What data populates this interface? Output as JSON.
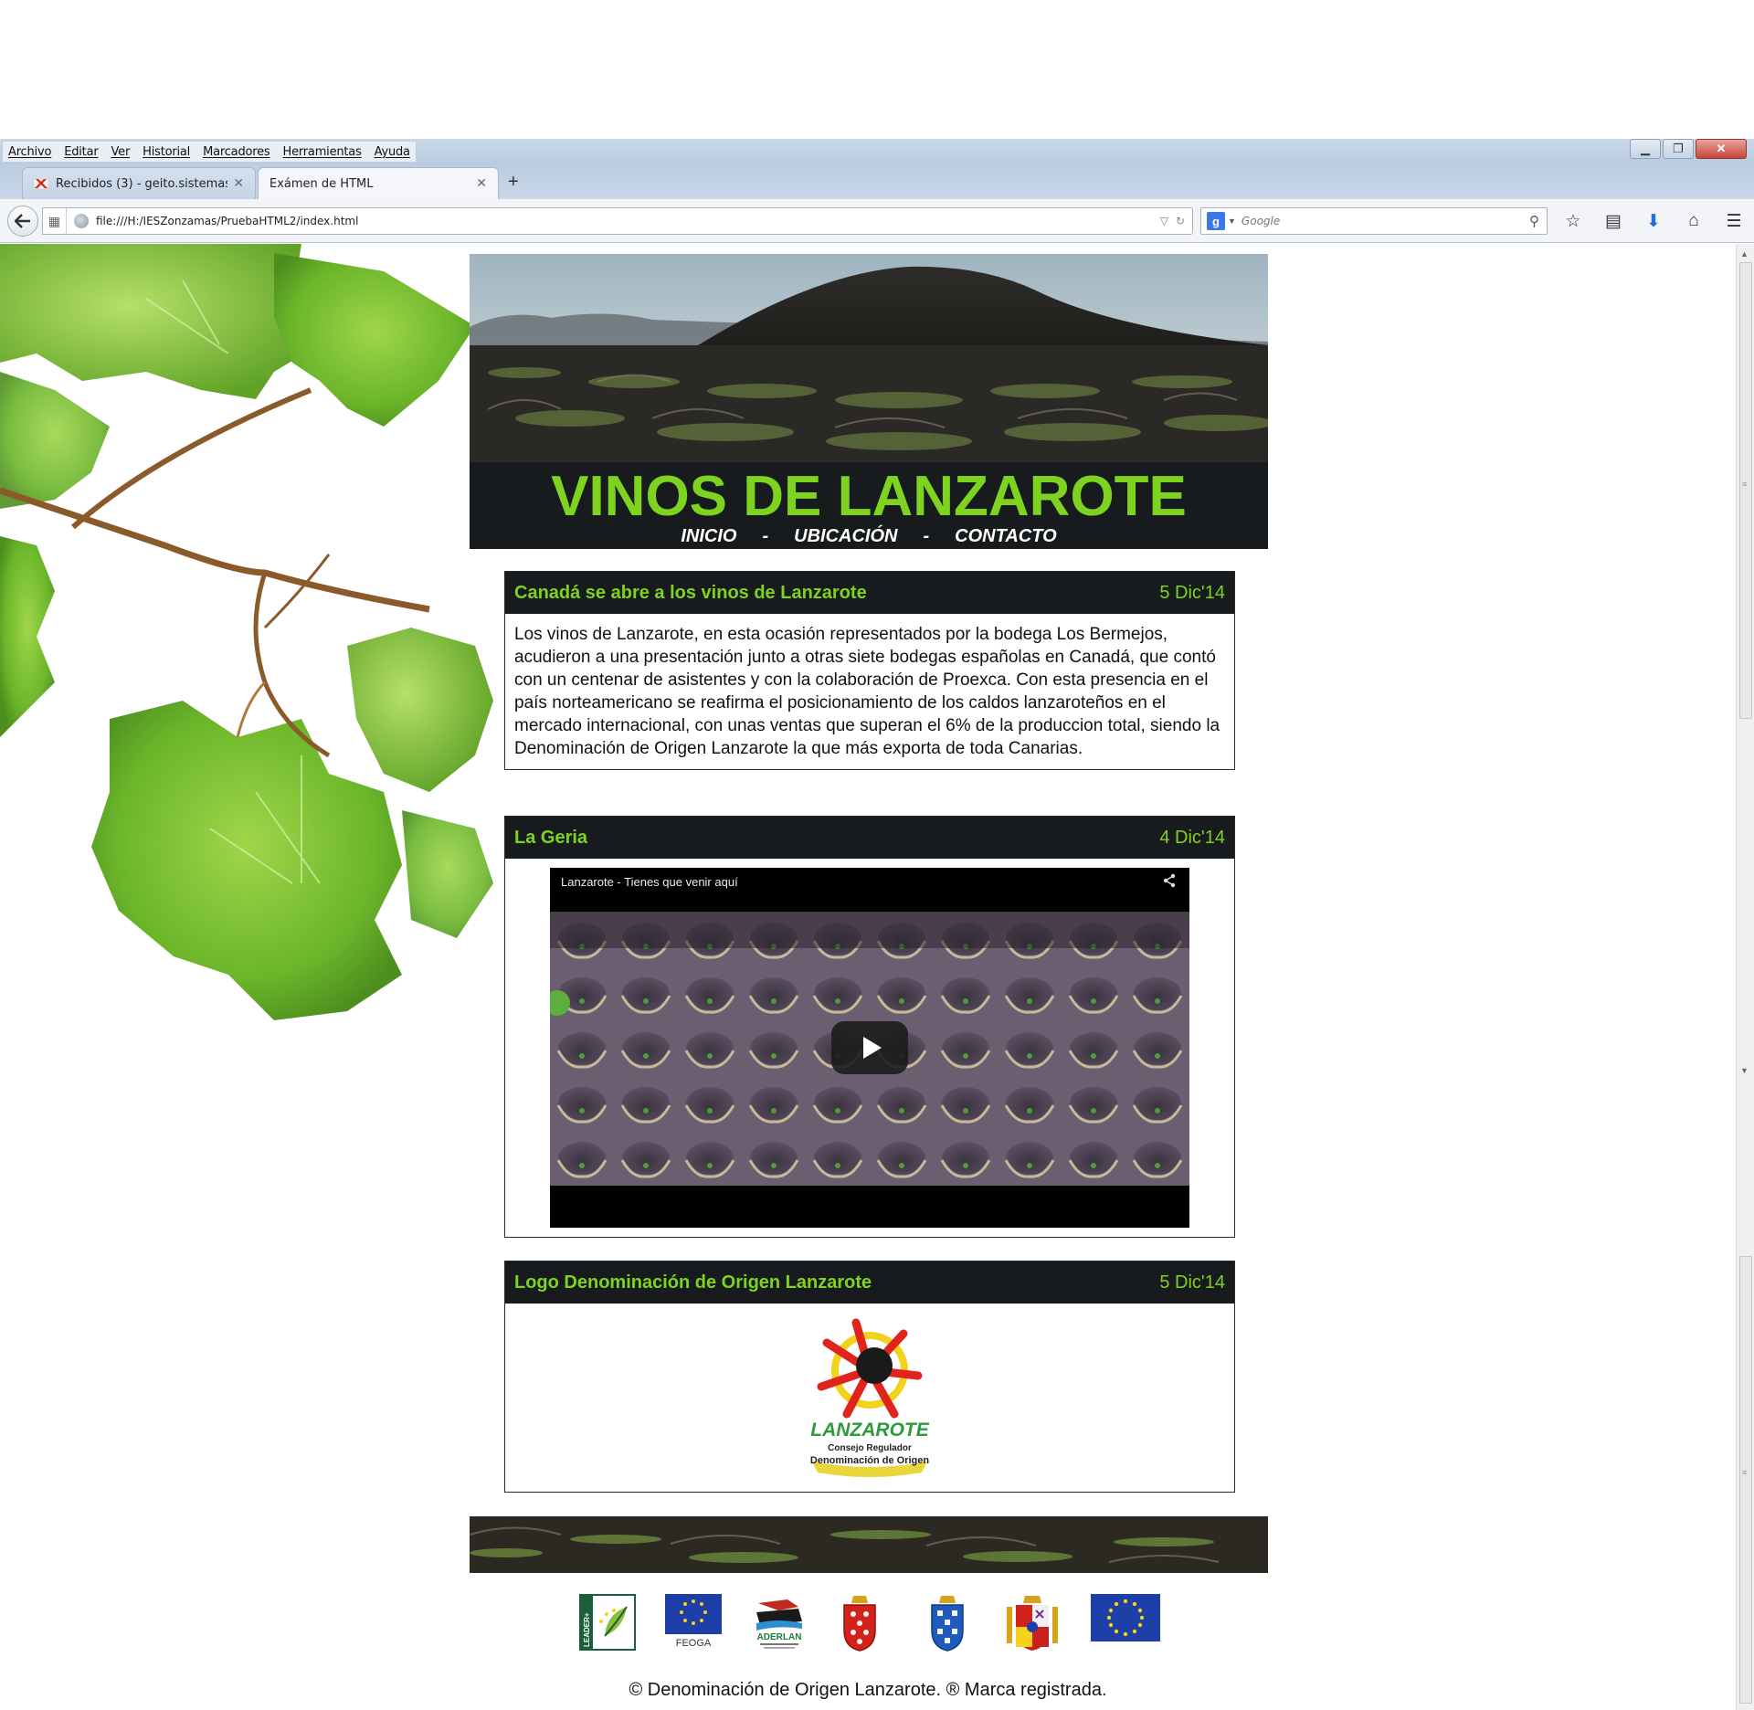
{
  "browser": {
    "menu": [
      "Archivo",
      "Editar",
      "Ver",
      "Historial",
      "Marcadores",
      "Herramientas",
      "Ayuda"
    ],
    "tabs": [
      {
        "label": "Recibidos (3) - geito.sistemas..."
      },
      {
        "label": "Exámen de HTML"
      }
    ],
    "url": "file:///H:/IESZonzamas/PruebaHTML2/index.html",
    "search_placeholder": "Google",
    "search_engine_badge": "g"
  },
  "site": {
    "title": "VINOS DE LANZAROTE",
    "nav": [
      "INICIO",
      "UBICACIÓN",
      "CONTACTO"
    ],
    "nav_separator": "-",
    "accent_color": "#7ed321",
    "dark_color": "#181b1d"
  },
  "articles": [
    {
      "title": "Canadá se abre a los vinos de Lanzarote",
      "date": "5 Dic'14",
      "text": "Los vinos de Lanzarote, en esta ocasión representados por la bodega Los Bermejos, acudieron a una presentación junto a otras siete bodegas españolas en Canadá, que contó con un centenar de asistentes y con la colaboración de Proexca. Con esta presencia en el país norteamericano se reafirma el posicionamiento de los caldos lanzaroteños en el mercado internacional, con unas ventas que superan el 6% de la produccion total, siendo la Denominación de Origen Lanzarote la que más exporta de toda Canarias."
    },
    {
      "title": "La Geria",
      "date": "4 Dic'14",
      "video_title": "Lanzarote - Tienes que venir aquí"
    },
    {
      "title": "Logo Denominación de Origen Lanzarote",
      "date": "5 Dic'14",
      "logo_word": "LANZAROTE",
      "logo_line1": "Consejo Regulador",
      "logo_line2": "Denominación de Origen"
    }
  ],
  "sponsors": {
    "leader": "LEADER+",
    "feoga": "FEOGA",
    "aderlan": "ADERLAN"
  },
  "footer": {
    "copyright": "© Denominación de Origen Lanzarote. ® Marca registrada."
  }
}
